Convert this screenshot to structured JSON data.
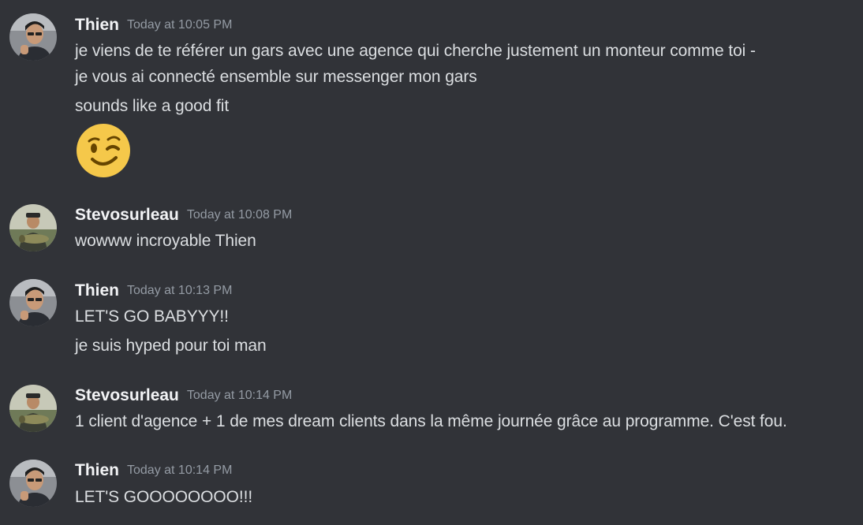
{
  "messages": [
    {
      "author": "Thien",
      "avatar": "thien-avatar",
      "timestamp": "Today at 10:05 PM",
      "lines": [
        "je viens de te référer un gars avec une agence qui cherche justement un monteur comme toi -",
        "je vous ai connecté ensemble sur messenger mon gars",
        "sounds like a good fit"
      ],
      "emoji": "winking-face-emoji"
    },
    {
      "author": "Stevosurleau",
      "avatar": "stevosurleau-avatar",
      "timestamp": "Today at 10:08 PM",
      "lines": [
        "wowww incroyable Thien"
      ]
    },
    {
      "author": "Thien",
      "avatar": "thien-avatar",
      "timestamp": "Today at 10:13 PM",
      "lines": [
        "LET'S GO BABYYY!!",
        "je suis hyped pour toi man"
      ]
    },
    {
      "author": "Stevosurleau",
      "avatar": "stevosurleau-avatar",
      "timestamp": "Today at 10:14 PM",
      "lines": [
        "1 client d'agence + 1 de mes dream clients dans la même journée grâce au programme. C'est fou."
      ]
    },
    {
      "author": "Thien",
      "avatar": "thien-avatar",
      "timestamp": "Today at 10:14 PM",
      "lines": [
        "LET'S GOOOOOOOO!!!"
      ]
    }
  ],
  "colors": {
    "background": "#313338",
    "author": "#f2f3f5",
    "timestamp": "#949ba4",
    "text": "#dbdee1",
    "emoji_face": "#f5c84a"
  }
}
